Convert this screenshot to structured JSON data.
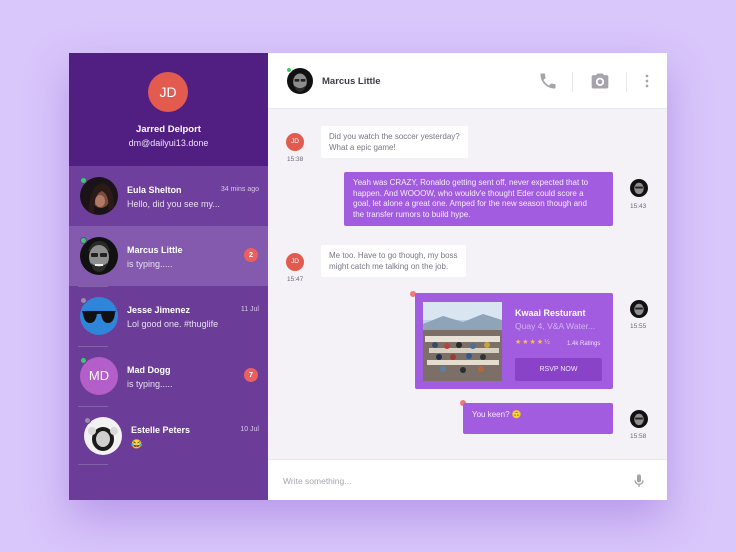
{
  "profile": {
    "initials": "JD",
    "name": "Jarred Delport",
    "email": "dm@dailyui13.done"
  },
  "contacts": [
    {
      "name": "Eula Shelton",
      "message": "Hello, did you see my...",
      "time": "34 mins ago",
      "online": true
    },
    {
      "name": "Marcus Little",
      "message": "is typing.....",
      "badge": "2",
      "online": true
    },
    {
      "name": "Jesse Jimenez",
      "message": "Lol good one. #thuglife",
      "time": "11 Jul",
      "online": false
    },
    {
      "name": "Mad Dogg",
      "initials": "MD",
      "message": "is typing.....",
      "badge": "7",
      "online": true
    },
    {
      "name": "Estelle Peters",
      "message": "😂",
      "time": "10 Jul",
      "online": false
    }
  ],
  "chat": {
    "header_name": "Marcus Little",
    "icons": [
      "phone-icon",
      "camera-icon",
      "more-vertical-icon"
    ],
    "messages": [
      {
        "from": "JD",
        "text_lines": [
          "Did you watch the soccer yesterday?",
          "What a epic game!"
        ],
        "time": "15:38"
      },
      {
        "from": "Marcus",
        "text_lines": [
          "Yeah was CRAZY, Ronaldo getting sent off, never expected that to",
          "happen. And WOOOW, who wouldv'e thought Eder could score a",
          "goal, let alone a great one. Amped for the new season though and",
          "the transfer rumors to build hype."
        ],
        "time": "15:43"
      },
      {
        "from": "JD",
        "text_lines": [
          "Me too. Have to go though, my boss",
          "might catch me talking on the job."
        ],
        "time": "15:47"
      },
      {
        "from": "Marcus",
        "time": "15:55"
      },
      {
        "from": "Marcus",
        "text": "You keen? 🙃",
        "time": "15:58"
      }
    ],
    "card": {
      "title": "Kwaai Resturant",
      "subtitle": "Quay 4, V&A Water...",
      "stars": "★★★★½",
      "rating": 4.5,
      "ratings_text": "1.4k Ratings",
      "button": "RSVP NOW"
    },
    "composer_placeholder": "Write something..."
  },
  "colors": {
    "background": "#d9c6fb",
    "sidebar": "#6b3d99",
    "profile_header": "#511e82",
    "accent": "#a25ce0",
    "online": "#3fc76b",
    "badge": "#ed5f5f"
  }
}
